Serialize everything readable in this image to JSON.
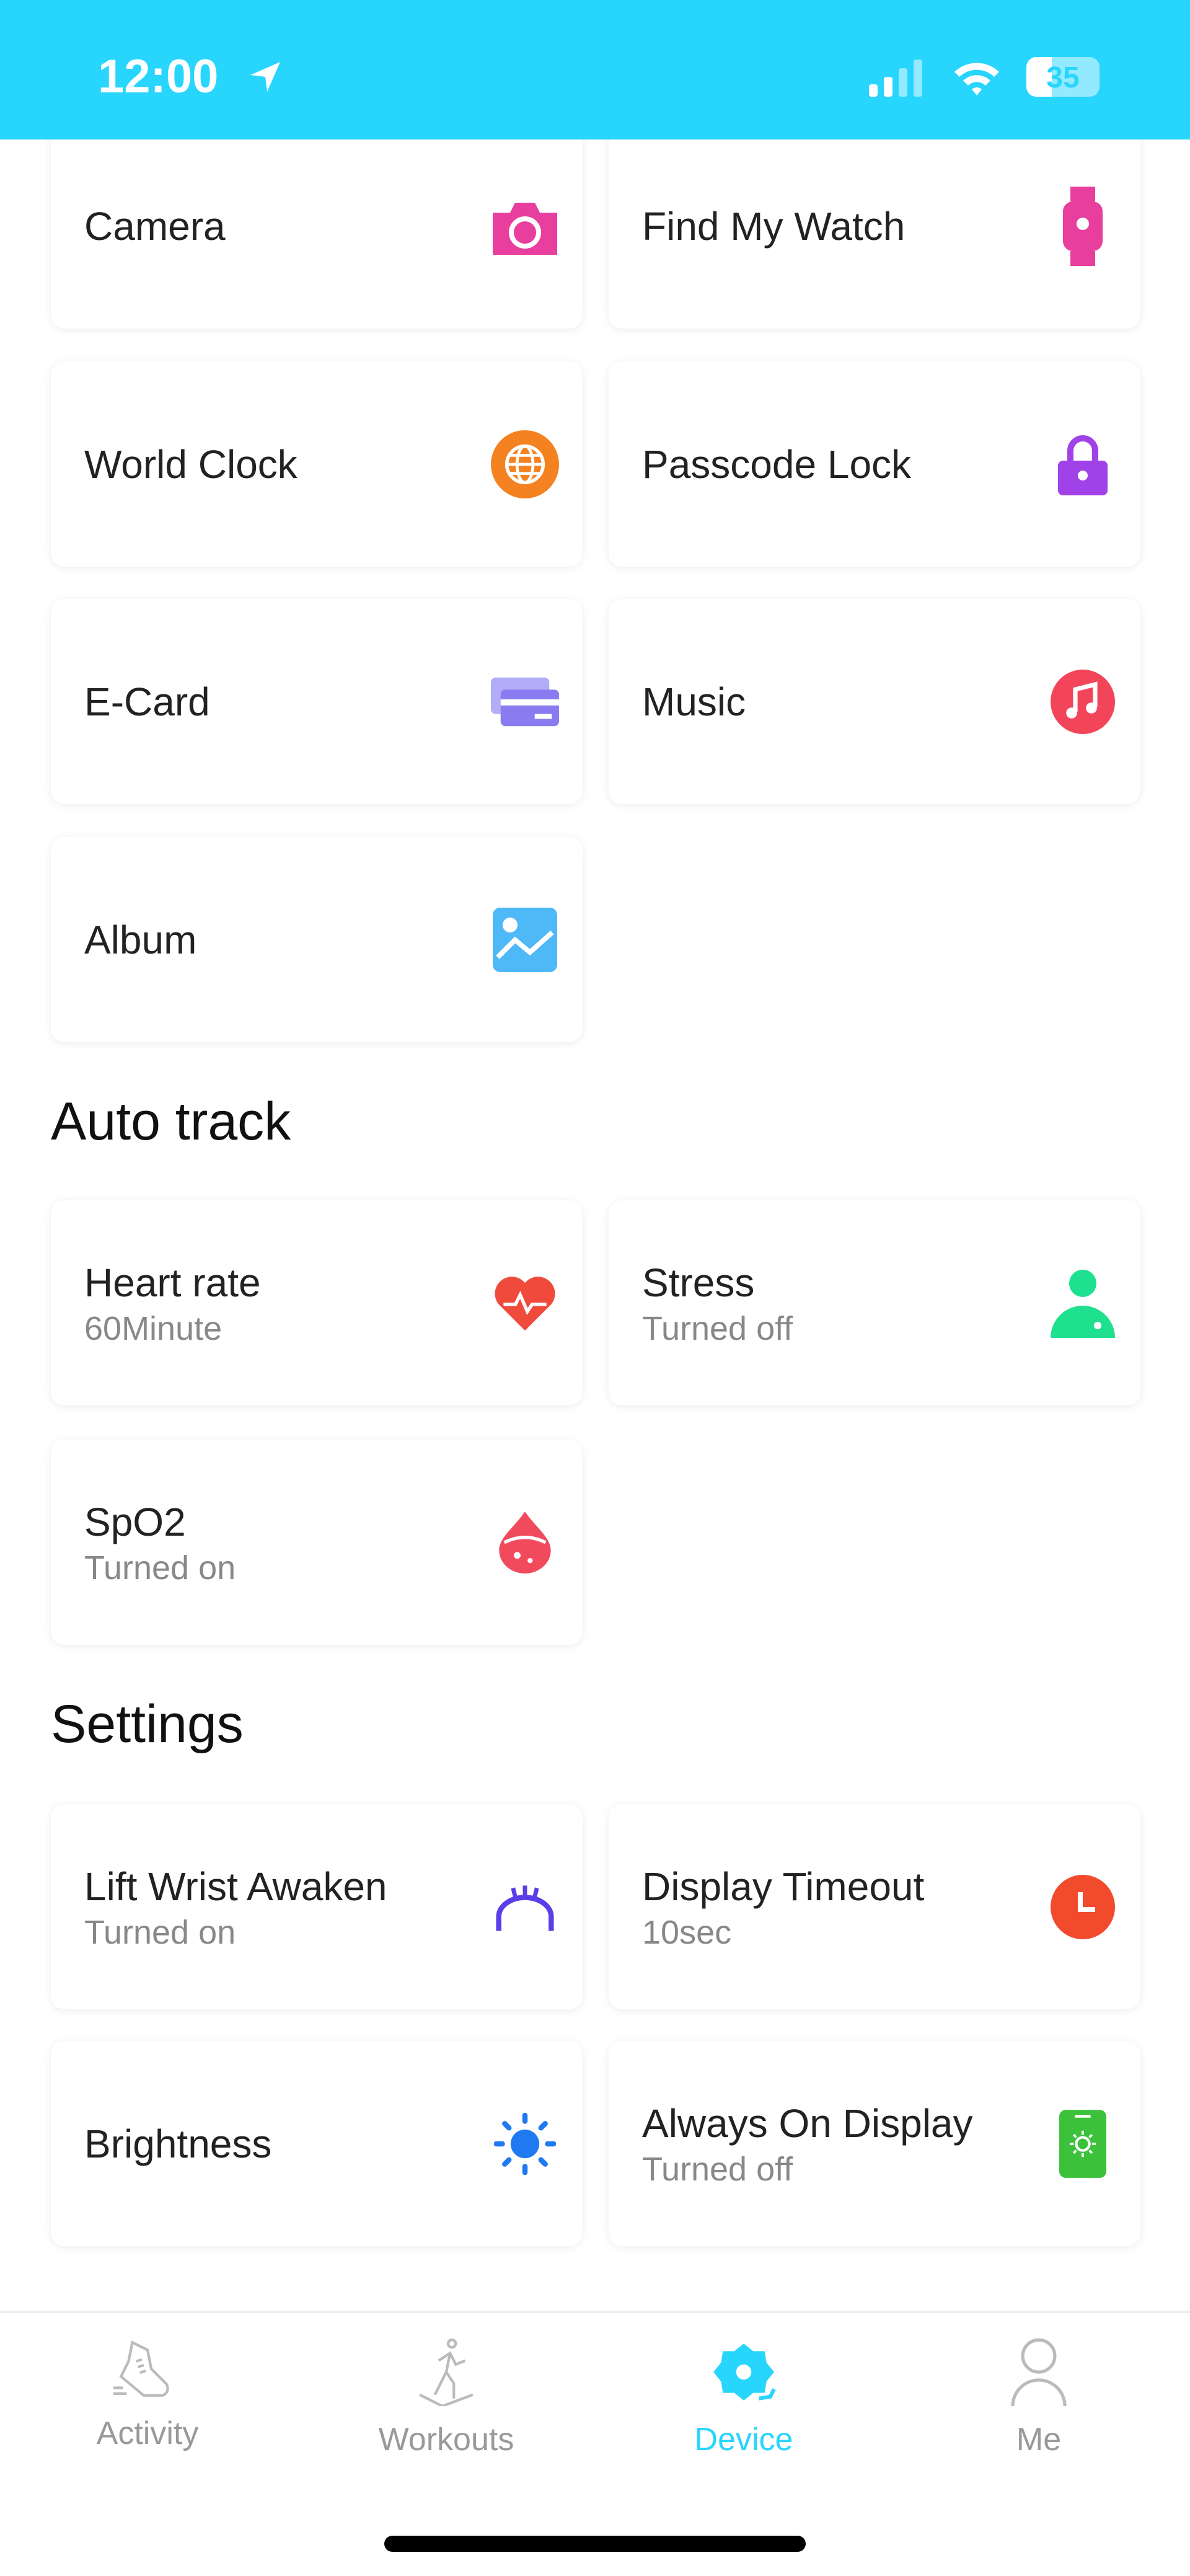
{
  "status_bar": {
    "time": "12:00",
    "battery": "35",
    "battery_level": 35
  },
  "accent_color": "#27d5fd",
  "features": [
    {
      "label": "Camera",
      "icon": "camera-icon",
      "color": "#e83e9e"
    },
    {
      "label": "Find My Watch",
      "icon": "watch-icon",
      "color": "#e83e9e"
    },
    {
      "label": "World Clock",
      "icon": "globe-icon",
      "color": "#f58220"
    },
    {
      "label": "Passcode Lock",
      "icon": "lock-icon",
      "color": "#a142e8"
    },
    {
      "label": "E-Card",
      "icon": "card-icon",
      "color": "#8a7cf0"
    },
    {
      "label": "Music",
      "icon": "music-icon",
      "color": "#f2455a"
    },
    {
      "label": "Album",
      "icon": "image-icon",
      "color": "#4fb8f7"
    }
  ],
  "auto_track": {
    "title": "Auto track",
    "items": [
      {
        "label": "Heart rate",
        "value": "60Minute",
        "icon": "heart-rate-icon",
        "color": "#f04a3c"
      },
      {
        "label": "Stress",
        "value": "Turned off",
        "icon": "person-icon",
        "color": "#1ee08f"
      },
      {
        "label": "SpO2",
        "value": "Turned on",
        "icon": "blood-drop-icon",
        "color": "#f04a5c"
      }
    ]
  },
  "settings": {
    "title": "Settings",
    "items": [
      {
        "label": "Lift Wrist Awaken",
        "value": "Turned on",
        "icon": "wrist-icon",
        "color": "#5a3ee8"
      },
      {
        "label": "Display Timeout",
        "value": "10sec",
        "icon": "clock-icon",
        "color": "#f24a2c"
      },
      {
        "label": "Brightness",
        "icon": "sun-icon",
        "color": "#1f7af2"
      },
      {
        "label": "Always On Display",
        "value": "Turned off",
        "icon": "phone-display-icon",
        "color": "#3cc23a"
      }
    ]
  },
  "tabs": [
    {
      "label": "Activity",
      "icon": "shoe-icon"
    },
    {
      "label": "Workouts",
      "icon": "runner-icon"
    },
    {
      "label": "Device",
      "icon": "device-gear-icon",
      "active": true
    },
    {
      "label": "Me",
      "icon": "user-icon"
    }
  ]
}
